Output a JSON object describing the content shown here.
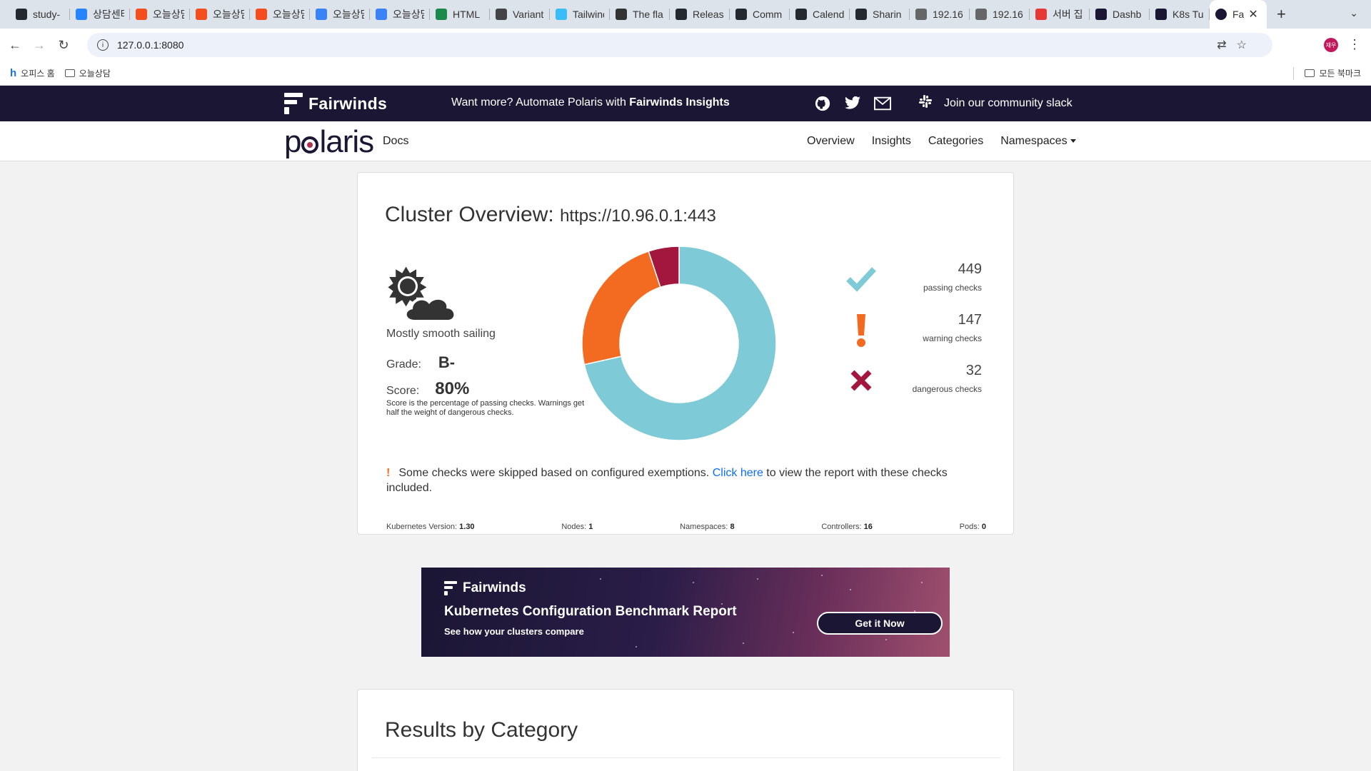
{
  "browser": {
    "tabs": [
      {
        "label": "study-",
        "icon": "github-icon",
        "color": "#24292f"
      },
      {
        "label": "상담센터",
        "icon": "jira-icon",
        "color": "#2684ff"
      },
      {
        "label": "오늘상담",
        "icon": "figma-icon",
        "color": "#f24e1e"
      },
      {
        "label": "오늘상담",
        "icon": "figma-icon",
        "color": "#f24e1e"
      },
      {
        "label": "오늘상담",
        "icon": "figma-icon",
        "color": "#f24e1e"
      },
      {
        "label": "오늘상담",
        "icon": "trello-icon",
        "color": "#3b82f6"
      },
      {
        "label": "오늘상담",
        "icon": "trello-icon",
        "color": "#3b82f6"
      },
      {
        "label": "HTML",
        "icon": "w-icon",
        "color": "#1a8a4a"
      },
      {
        "label": "Variant",
        "icon": "image-icon",
        "color": "#444"
      },
      {
        "label": "Tailwind",
        "icon": "tailwind-icon",
        "color": "#38bdf8"
      },
      {
        "label": "The fla",
        "icon": "flag-icon",
        "color": "#333"
      },
      {
        "label": "Releas",
        "icon": "github-icon",
        "color": "#24292f"
      },
      {
        "label": "Comm",
        "icon": "github-icon",
        "color": "#24292f"
      },
      {
        "label": "Calend",
        "icon": "github-icon",
        "color": "#24292f"
      },
      {
        "label": "Sharin",
        "icon": "github-icon",
        "color": "#24292f"
      },
      {
        "label": "192.16",
        "icon": "globe-icon",
        "color": "#666"
      },
      {
        "label": "192.16",
        "icon": "globe-icon",
        "color": "#666"
      },
      {
        "label": "서버 집",
        "icon": "server-icon",
        "color": "#e53935"
      },
      {
        "label": "Dashb",
        "icon": "fairwinds-icon",
        "color": "#1b1634"
      },
      {
        "label": "K8s Tu",
        "icon": "fairwinds-icon",
        "color": "#1b1634"
      }
    ],
    "active_tab": {
      "label": "Fa",
      "icon": "polaris-icon"
    },
    "url": "127.0.0.1:8080",
    "profile_label": "재우",
    "bookmarks": [
      {
        "label": "오피스 홈",
        "icon": "h-icon"
      },
      {
        "label": "오늘상담",
        "icon": "folder-icon"
      }
    ],
    "all_bookmarks": "모든 북마크"
  },
  "topbar": {
    "brand": "Fairwinds",
    "promo_prefix": "Want more? Automate Polaris with ",
    "promo_bold": "Fairwinds Insights",
    "slack": "Join our community slack"
  },
  "nav": {
    "logo_p": "p",
    "logo_rest": "laris",
    "docs": "Docs",
    "items": [
      "Overview",
      "Insights",
      "Categories",
      "Namespaces"
    ]
  },
  "overview": {
    "title": "Cluster Overview:",
    "cluster_url": "https://10.96.0.1:443",
    "weather": "Mostly smooth sailing",
    "grade_label": "Grade:",
    "grade": "B-",
    "score_label": "Score:",
    "score": "80%",
    "score_note": "Score is the percentage of passing checks. Warnings get half the weight of dangerous checks.",
    "checks": [
      {
        "count": "449",
        "label": "passing checks",
        "icon": "checkmark-icon",
        "color": "#7ecad6"
      },
      {
        "count": "147",
        "label": "warning checks",
        "icon": "exclamation-icon",
        "color": "#f26b21"
      },
      {
        "count": "32",
        "label": "dangerous checks",
        "icon": "x-icon",
        "color": "#a3163e"
      }
    ],
    "exempt_text": "Some checks were skipped based on configured exemptions.",
    "exempt_link": "Click here",
    "exempt_tail": " to view the report with these checks included.",
    "stats": [
      {
        "label": "Kubernetes Version:",
        "value": "1.30"
      },
      {
        "label": "Nodes:",
        "value": "1"
      },
      {
        "label": "Namespaces:",
        "value": "8"
      },
      {
        "label": "Controllers:",
        "value": "16"
      },
      {
        "label": "Pods:",
        "value": "0"
      }
    ]
  },
  "chart_data": {
    "type": "pie",
    "categories": [
      "passing checks",
      "warning checks",
      "dangerous checks"
    ],
    "values": [
      449,
      147,
      32
    ],
    "colors": [
      "#7ecad6",
      "#f26b21",
      "#a3163e"
    ],
    "donut": true
  },
  "banner": {
    "brand": "Fairwinds",
    "title": "Kubernetes Configuration Benchmark Report",
    "subtitle": "See how your clusters compare",
    "button": "Get it Now"
  },
  "results": {
    "title": "Results by Category"
  }
}
